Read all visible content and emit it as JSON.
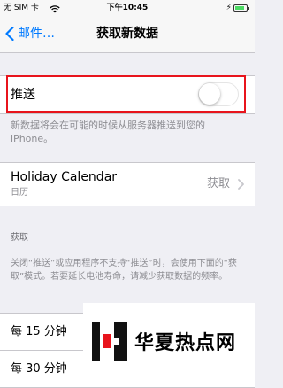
{
  "status_bar": {
    "carrier": "无 SIM 卡",
    "time": "下午10:45",
    "battery_level": 0.85
  },
  "nav": {
    "back_label": "邮件…",
    "title": "获取新数据"
  },
  "push": {
    "label": "推送",
    "enabled": false,
    "note": "新数据将会在可能的时候从服务器推送到您的iPhone。"
  },
  "account": {
    "title": "Holiday Calendar",
    "subtitle": "日历",
    "value": "获取"
  },
  "fetch": {
    "header": "获取",
    "note": "关闭“推送”或应用程序不支持“推送”时，会使用下面的“获取”模式。若要延长电池寿命，请减少获取数据的频率。"
  },
  "options": [
    {
      "label": "每 15 分钟"
    },
    {
      "label": "每 30 分钟"
    }
  ],
  "watermark": {
    "text": "华夏热点网"
  },
  "colors": {
    "accent": "#007aff",
    "highlight": "#e8141c",
    "background": "#efeff4"
  }
}
